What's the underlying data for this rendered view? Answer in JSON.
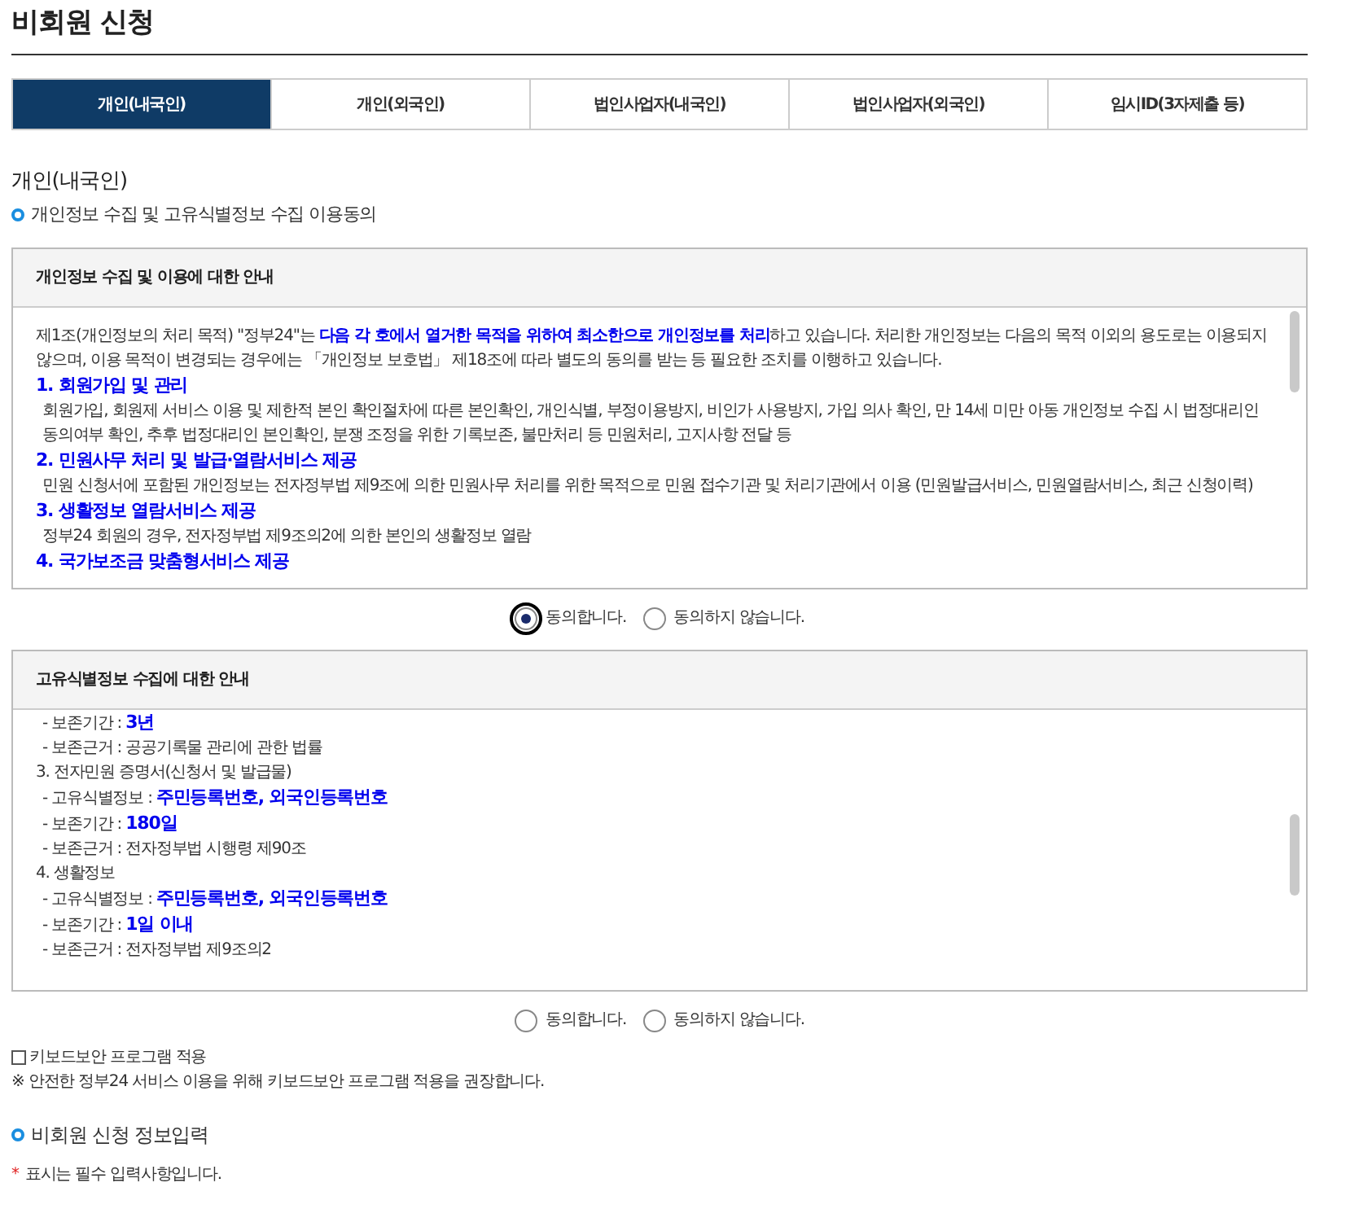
{
  "page_title": "비회원 신청",
  "tabs": [
    {
      "label": "개인(내국인)",
      "selected": true
    },
    {
      "label": "개인(외국인)",
      "selected": false
    },
    {
      "label": "법인사업자(내국인)",
      "selected": false
    },
    {
      "label": "법인사업자(외국인)",
      "selected": false
    },
    {
      "label": "임시ID(3자제출 등)",
      "selected": false
    }
  ],
  "section_title": "개인(내국인)",
  "consent_heading": "개인정보 수집 및 고유식별정보 수집 이용동의",
  "panels": [
    {
      "title": "개인정보 수집 및 이용에 대한 안내",
      "lines": [
        {
          "kind": "para",
          "text": "제1조(개인정보의 처리 목적) \"정부24\"는 **다음 각 호에서 열거한 목적을 위하여 최소한으로 개인정보를 처리**하고 있습니다. 처리한 개인정보는 다음의 목적 이외의 용도로는 이용되지 않으며, 이용 목적이 변경되는 경우에는 「개인정보 보호법」 제18조에 따라 별도의 동의를 받는 등 필요한 조치를 이행하고 있습니다."
        },
        {
          "kind": "heading",
          "text": "1. 회원가입 및 관리"
        },
        {
          "kind": "desc",
          "text": "회원가입, 회원제 서비스 이용 및 제한적 본인 확인절차에 따른 본인확인, 개인식별, 부정이용방지, 비인가 사용방지, 가입 의사 확인, 만 14세 미만 아동 개인정보 수집 시 법정대리인 동의여부 확인, 추후 법정대리인 본인확인, 분쟁 조정을 위한 기록보존, 불만처리 등 민원처리, 고지사항 전달 등"
        },
        {
          "kind": "heading",
          "text": "2. 민원사무 처리 및 발급·열람서비스 제공"
        },
        {
          "kind": "desc",
          "text": "민원 신청서에 포함된 개인정보는 전자정부법 제9조에 의한 민원사무 처리를 위한 목적으로 민원 접수기관 및 처리기관에서 이용 (민원발급서비스, 민원열람서비스, 최근 신청이력)"
        },
        {
          "kind": "heading",
          "text": "3. 생활정보 열람서비스 제공"
        },
        {
          "kind": "desc",
          "text": "정부24 회원의 경우, 전자정부법 제9조의2에 의한 본인의 생활정보 열람"
        },
        {
          "kind": "heading",
          "text": "4. 국가보조금 맞춤형서비스 제공"
        }
      ],
      "options": [
        {
          "label": "동의합니다.",
          "selected": true
        },
        {
          "label": "동의하지 않습니다.",
          "selected": false
        }
      ]
    },
    {
      "title": "고유식별정보 수집에 대한 안내",
      "lines": [
        {
          "kind": "sub",
          "label": "- 보존기간 : ",
          "value": "3년"
        },
        {
          "kind": "plain",
          "text": "- 보존근거 : 공공기록물 관리에 관한 법률"
        },
        {
          "kind": "item",
          "text": "3. 전자민원 증명서(신청서 및 발급물)"
        },
        {
          "kind": "sub",
          "label": "- 고유식별정보 : ",
          "value": "주민등록번호, 외국인등록번호"
        },
        {
          "kind": "sub",
          "label": "- 보존기간 : ",
          "value": "180일"
        },
        {
          "kind": "plain",
          "text": "- 보존근거 : 전자정부법 시행령 제90조"
        },
        {
          "kind": "item",
          "text": "4. 생활정보"
        },
        {
          "kind": "sub",
          "label": "- 고유식별정보 : ",
          "value": "주민등록번호, 외국인등록번호"
        },
        {
          "kind": "sub",
          "label": "- 보존기간 : ",
          "value": "1일 이내"
        },
        {
          "kind": "plain",
          "text": "- 보존근거 : 전자정부법 제9조의2"
        }
      ],
      "options": [
        {
          "label": "동의합니다.",
          "selected": false
        },
        {
          "label": "동의하지 않습니다.",
          "selected": false
        }
      ]
    }
  ],
  "keyboard_security": {
    "label": "키보드보안 프로그램 적용",
    "checked": false
  },
  "keyboard_note": "※ 안전한 정부24 서비스 이용을 위해 키보드보안 프로그램 적용을 권장합니다.",
  "input_heading": "비회원 신청 정보입력",
  "required_note": {
    "mark": "*",
    "text": "표시는 필수 입력사항입니다."
  }
}
